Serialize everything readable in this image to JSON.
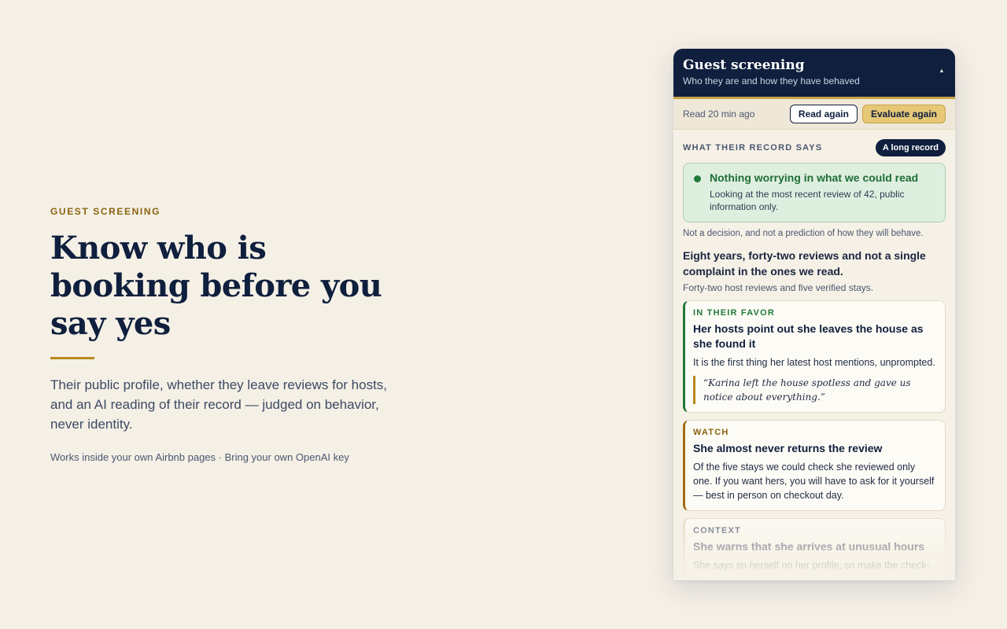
{
  "hero": {
    "eyebrow": "GUEST SCREENING",
    "headline": "Know who is booking before you say yes",
    "lede": "Their public profile, whether they leave reviews for hosts, and an AI reading of their record — judged on behavior, never identity.",
    "fine": "Works inside your own Airbnb pages · Bring your own OpenAI key"
  },
  "panel": {
    "title": "Guest screening",
    "subtitle": "Who they are and how they have behaved",
    "collapse_icon": "triangle-up-icon",
    "status": "Read 20 min ago",
    "read_again": "Read again",
    "evaluate_again": "Evaluate again",
    "section_label": "WHAT THEIR RECORD SAYS",
    "badge": "A long record",
    "verdict": {
      "title": "Nothing worrying in what we could read",
      "text": "Looking at the most recent review of 42, public information only."
    },
    "disclaimer": "Not a decision, and not a prediction of how they will behave.",
    "summary": "Eight years, forty-two reviews and not a single complaint in the ones we read.",
    "summary_sub": "Forty-two host reviews and five verified stays.",
    "cards": [
      {
        "kicker": "IN THEIR FAVOR",
        "title": "Her hosts point out she leaves the house as she found it",
        "text": "It is the first thing her latest host mentions, unprompted.",
        "quote": "“Karina left the house spotless and gave us notice about everything.”"
      },
      {
        "kicker": "WATCH",
        "title": "She almost never returns the review",
        "text": "Of the five stays we could check she reviewed only one. If you want hers, you will have to ask for it yourself — best in person on checkout day."
      },
      {
        "kicker": "CONTEXT",
        "title": "She warns that she arrives at unusual hours",
        "text": "She says so herself on her profile, so make the check-"
      }
    ]
  },
  "colors": {
    "background": "#f5f0e6",
    "navy": "#0f1f3d",
    "gold": "#b8891f",
    "green": "#217a3a"
  }
}
